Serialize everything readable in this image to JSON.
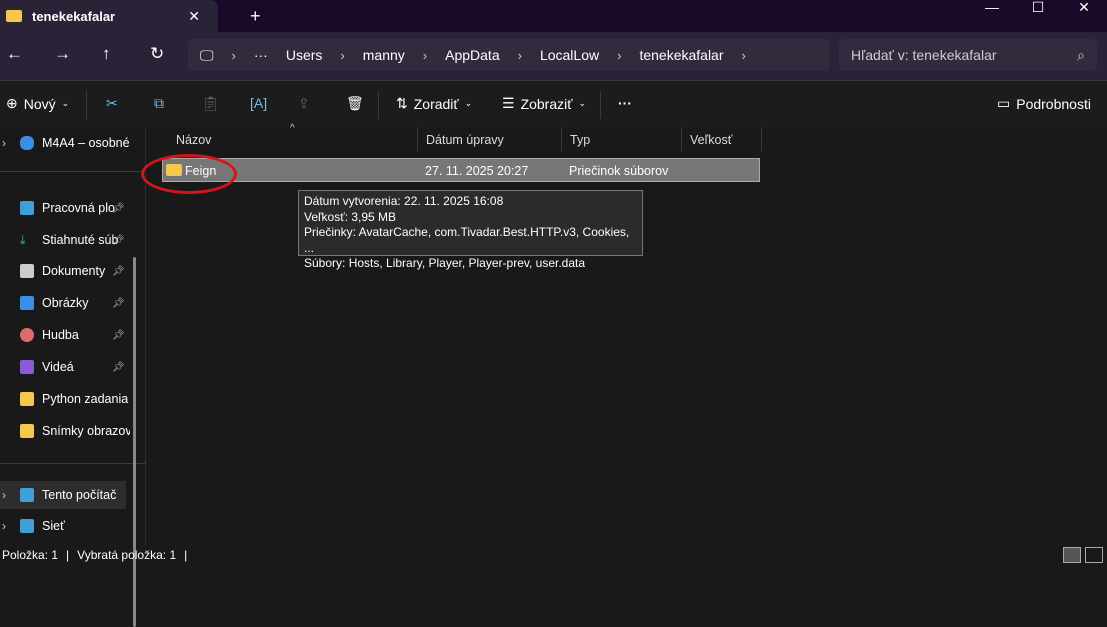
{
  "tab": {
    "title": "tenekekafalar",
    "close": "✕",
    "new": "+"
  },
  "window": {
    "min": "—",
    "max": "☐",
    "close": "✕"
  },
  "nav": {
    "back": "←",
    "forward": "→",
    "up": "↑",
    "refresh": "↻"
  },
  "breadcrumb": {
    "more": "···",
    "items": [
      "Users",
      "manny",
      "AppData",
      "LocalLow",
      "tenekekafalar"
    ],
    "sep": "›"
  },
  "search": {
    "placeholder": "Hľadať v: tenekekafalar",
    "icon": "⌕"
  },
  "toolbar": {
    "new": "Nový",
    "sort": "Zoradiť",
    "view": "Zobraziť",
    "more": "···",
    "details": "Podrobnosti"
  },
  "sidebar": {
    "cloud": "M4A4 – osobné",
    "items": [
      "Pracovná plo",
      "Stiahnuté súb",
      "Dokumenty",
      "Obrázky",
      "Hudba",
      "Videá",
      "Python zadania",
      "Snímky obrazov"
    ],
    "pc": "Tento počítač",
    "network": "Sieť"
  },
  "columns": [
    "Názov",
    "Dátum úpravy",
    "Typ",
    "Veľkosť"
  ],
  "rows": [
    {
      "name": "Feign",
      "date": "27. 11. 2025 20:27",
      "type": "Priečinok súborov"
    }
  ],
  "tooltip": [
    "Dátum vytvorenia: 22. 11. 2025 16:08",
    "Veľkosť: 3,95 MB",
    "Priečinky: AvatarCache, com.Tivadar.Best.HTTP.v3, Cookies, ...",
    "Súbory: Hosts, Library, Player, Player-prev, user.data"
  ],
  "status": {
    "count": "Položka: 1",
    "selected": "Vybratá položka: 1"
  }
}
